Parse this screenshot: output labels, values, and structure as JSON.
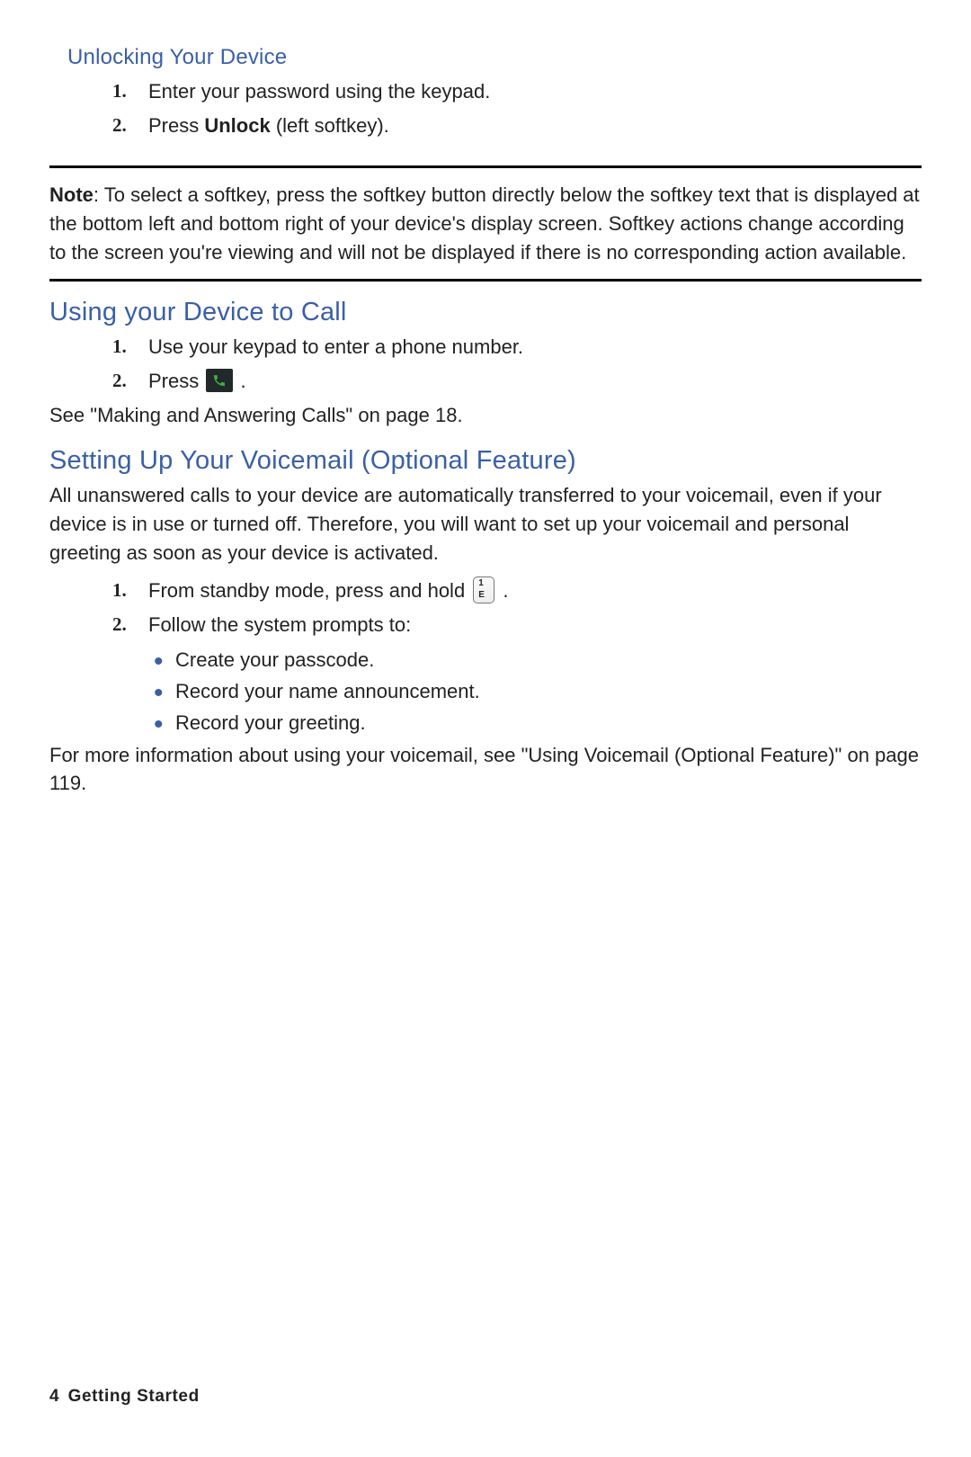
{
  "sec1": {
    "title": "Unlocking Your Device",
    "steps": [
      "Enter your password using the keypad.",
      {
        "pre": "Press ",
        "bold": "Unlock",
        "post": " (left softkey)."
      }
    ]
  },
  "note": {
    "label": "Note",
    "text": ": To select a softkey, press the softkey button directly below the softkey text that is displayed at the bottom left and bottom right of your device's display screen. Softkey actions change according to the screen you're viewing and will not be displayed if there is no corresponding action available."
  },
  "sec2": {
    "title": "Using your Device to Call",
    "steps": [
      "Use your keypad to enter a phone number.",
      {
        "pre": "Press  ",
        "icon": "call",
        "post": " ."
      }
    ],
    "ref": "See \"Making and Answering Calls\" on page 18."
  },
  "sec3": {
    "title": "Setting Up Your Voicemail (Optional Feature)",
    "intro": "All unanswered calls to your device are automatically transferred to your voicemail, even if your device is in use or turned off. Therefore, you will want to set up your voicemail and personal greeting as soon as your device is activated.",
    "steps": [
      {
        "pre": "From standby mode, press and hold  ",
        "icon": "key1",
        "post": " ."
      },
      "Follow the system prompts to:"
    ],
    "bullets": [
      "Create your passcode.",
      "Record your name announcement.",
      "Record your greeting."
    ],
    "ref": "For more information about using your voicemail, see \"Using Voicemail (Optional Feature)\" on page 119."
  },
  "footer": {
    "page": "4",
    "chapter": "Getting Started"
  },
  "markers": [
    "1.",
    "2."
  ],
  "keyicon": {
    "top": "1",
    "bottom": "E"
  }
}
